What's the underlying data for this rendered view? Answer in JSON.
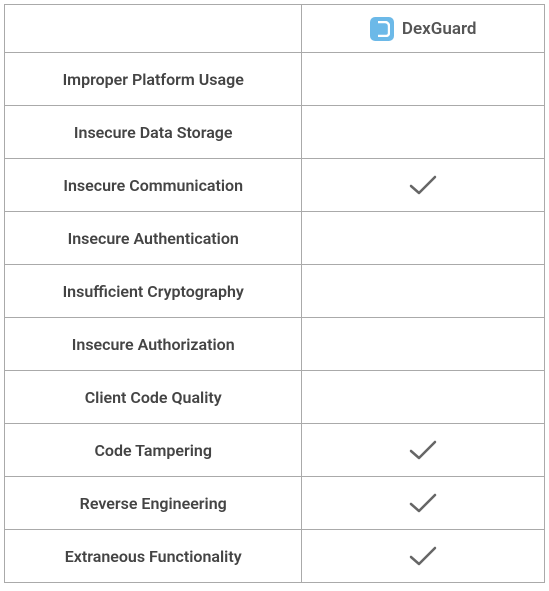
{
  "header": {
    "product_name": "DexGuard",
    "logo_name": "dexguard-logo"
  },
  "rows": [
    {
      "label": "Improper Platform Usage",
      "checked": false
    },
    {
      "label": "Insecure Data Storage",
      "checked": false
    },
    {
      "label": "Insecure Communication",
      "checked": true
    },
    {
      "label": "Insecure Authentication",
      "checked": false
    },
    {
      "label": "Insufficient Cryptography",
      "checked": false
    },
    {
      "label": "Insecure Authorization",
      "checked": false
    },
    {
      "label": "Client Code Quality",
      "checked": false
    },
    {
      "label": "Code Tampering",
      "checked": true
    },
    {
      "label": "Reverse Engineering",
      "checked": true
    },
    {
      "label": "Extraneous Functionality",
      "checked": true
    }
  ]
}
